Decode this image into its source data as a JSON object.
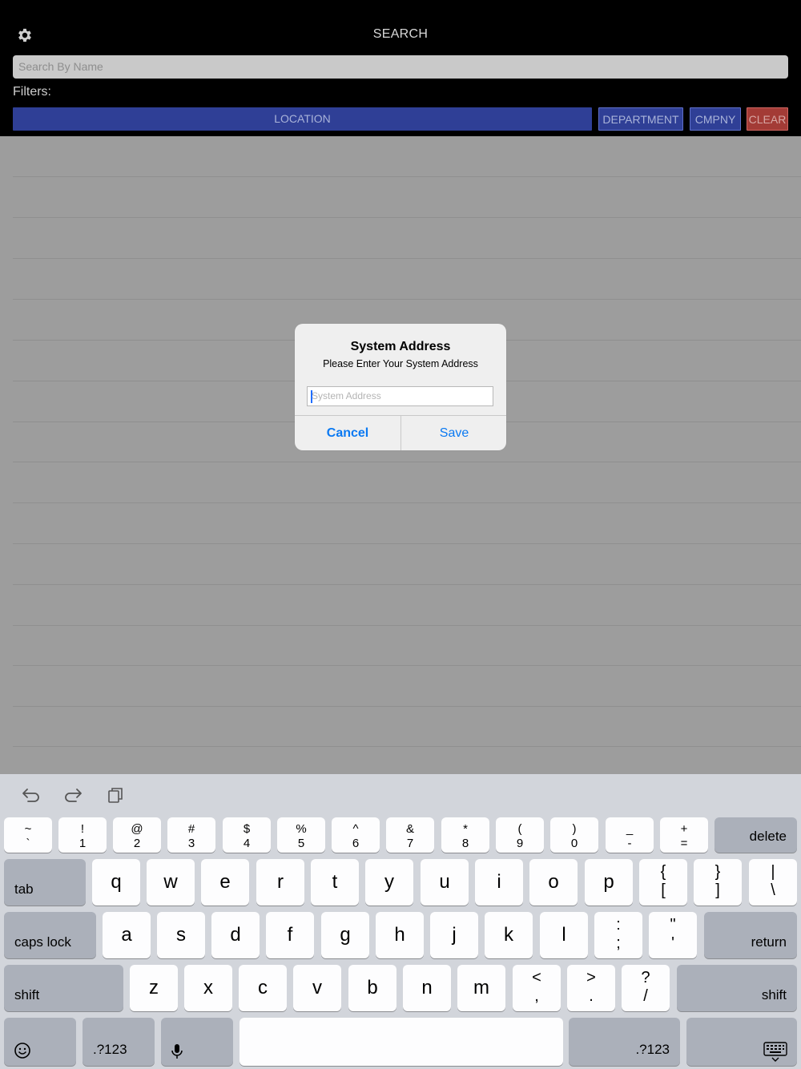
{
  "header": {
    "title": "SEARCH",
    "search_placeholder": "Search By Name",
    "filters_label": "Filters:",
    "filter_buttons": {
      "location": "LOCATION",
      "department": "DEPARTMENT",
      "company": "CMPNY",
      "clear": "CLEAR"
    }
  },
  "dialog": {
    "title": "System Address",
    "message": "Please Enter Your System Address",
    "input_placeholder": "System Address",
    "cancel_label": "Cancel",
    "save_label": "Save"
  },
  "keyboard": {
    "toolbar": [
      "undo-icon",
      "redo-icon",
      "paste-icon"
    ],
    "row1": [
      {
        "top": "~",
        "bottom": "`"
      },
      {
        "top": "!",
        "bottom": "1"
      },
      {
        "top": "@",
        "bottom": "2"
      },
      {
        "top": "#",
        "bottom": "3"
      },
      {
        "top": "$",
        "bottom": "4"
      },
      {
        "top": "%",
        "bottom": "5"
      },
      {
        "top": "^",
        "bottom": "6"
      },
      {
        "top": "&",
        "bottom": "7"
      },
      {
        "top": "*",
        "bottom": "8"
      },
      {
        "top": "(",
        "bottom": "9"
      },
      {
        "top": ")",
        "bottom": "0"
      },
      {
        "top": "_",
        "bottom": "-"
      },
      {
        "top": "+",
        "bottom": "="
      }
    ],
    "delete_label": "delete",
    "tab_label": "tab",
    "row2_letters": [
      "q",
      "w",
      "e",
      "r",
      "t",
      "y",
      "u",
      "i",
      "o",
      "p"
    ],
    "row2_symbols": [
      {
        "top": "{",
        "bottom": "["
      },
      {
        "top": "}",
        "bottom": "]"
      },
      {
        "top": "|",
        "bottom": "\\"
      }
    ],
    "caps_label": "caps lock",
    "row3_letters": [
      "a",
      "s",
      "d",
      "f",
      "g",
      "h",
      "j",
      "k",
      "l"
    ],
    "row3_symbols": [
      {
        "top": ":",
        "bottom": ";"
      },
      {
        "top": "\"",
        "bottom": "'"
      }
    ],
    "return_label": "return",
    "shift_label": "shift",
    "row4_letters": [
      "z",
      "x",
      "c",
      "v",
      "b",
      "n",
      "m"
    ],
    "row4_symbols": [
      {
        "top": "<",
        "bottom": ","
      },
      {
        "top": ">",
        "bottom": "."
      },
      {
        "top": "?",
        "bottom": "/"
      }
    ],
    "numbers_label": ".?123"
  }
}
